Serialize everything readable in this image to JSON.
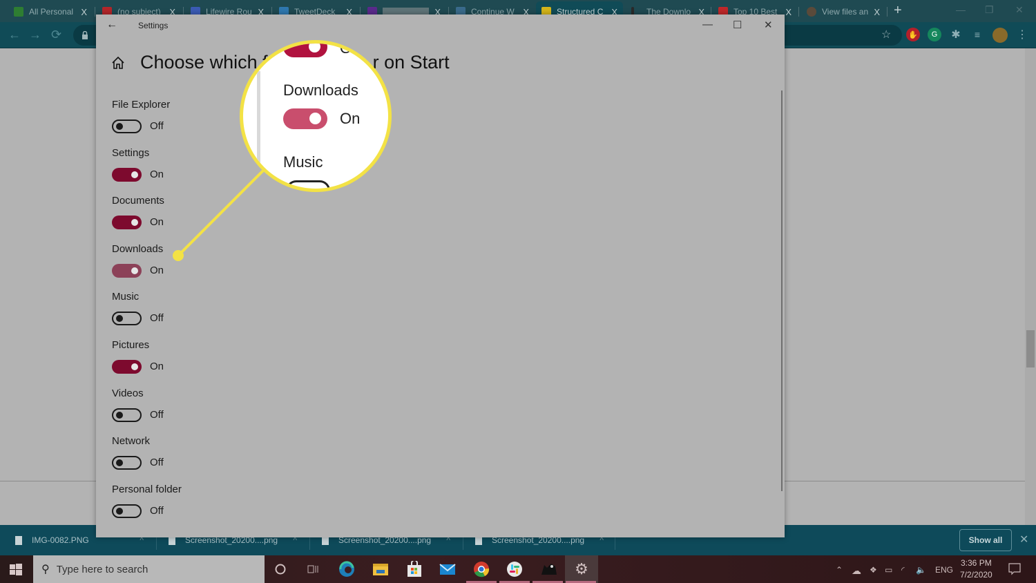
{
  "browser": {
    "tabs": [
      {
        "title": "All Personal",
        "favicon_color": "#2e7d32",
        "active": false
      },
      {
        "title": "(no subject)",
        "favicon_color": "#b3262a",
        "active": false
      },
      {
        "title": "Lifewire Rou",
        "favicon_color": "#3b5bb5",
        "active": false
      },
      {
        "title": "TweetDeck",
        "favicon_color": "#2f78b0",
        "active": false
      },
      {
        "title": "",
        "favicon_color": "#5a2a8c",
        "active": false
      },
      {
        "title": "Continue W",
        "favicon_color": "#3a6b8c",
        "active": false
      },
      {
        "title": "Structured C",
        "favicon_color": "#d4b51a",
        "active": true
      },
      {
        "title": "The Downlo",
        "favicon_color": "#2a2a2a",
        "active": false
      },
      {
        "title": "Top 10 Best",
        "favicon_color": "#c0282a",
        "active": false
      },
      {
        "title": "View files an",
        "favicon_color": "#5a4a3a",
        "active": false
      }
    ],
    "close_glyph": "X",
    "new_tab_glyph": "+",
    "extensions": [
      {
        "name": "adblock-icon",
        "color": "#b3202a"
      },
      {
        "name": "grammarly-icon",
        "color": "#15875c"
      }
    ]
  },
  "downloads": {
    "items": [
      {
        "name": "IMG-0082.PNG"
      },
      {
        "name": "Screenshot_20200....png"
      },
      {
        "name": "Screenshot_20200....png"
      },
      {
        "name": "Screenshot_20200....png"
      }
    ],
    "show_all_label": "Show all",
    "close_glyph": "✕"
  },
  "settings_window": {
    "title": "Settings",
    "page_title": "Choose which folders appear on Start",
    "page_title_visible_left": "Choose which f",
    "page_title_visible_right": "r on Start",
    "options": [
      {
        "label": "File Explorer",
        "state": "Off",
        "on": false
      },
      {
        "label": "Settings",
        "state": "On",
        "on": true
      },
      {
        "label": "Documents",
        "state": "On",
        "on": true
      },
      {
        "label": "Downloads",
        "state": "On",
        "on": true,
        "highlighted": true
      },
      {
        "label": "Music",
        "state": "Off",
        "on": false
      },
      {
        "label": "Pictures",
        "state": "On",
        "on": true
      },
      {
        "label": "Videos",
        "state": "Off",
        "on": false
      },
      {
        "label": "Network",
        "state": "Off",
        "on": false
      },
      {
        "label": "Personal folder",
        "state": "Off",
        "on": false
      }
    ]
  },
  "callout": {
    "label": "Downloads",
    "state": "On",
    "next_label": "Music",
    "top_state_partial": "O",
    "color": "#f3e245"
  },
  "taskbar": {
    "search_placeholder": "Type here to search",
    "tray": {
      "language": "ENG",
      "time": "3:36 PM",
      "date": "7/2/2020"
    }
  }
}
